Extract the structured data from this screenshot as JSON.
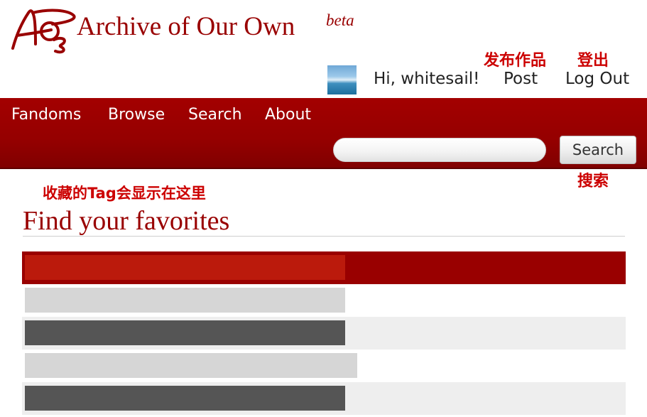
{
  "header": {
    "site_title": "Archive of Our Own",
    "beta_label": "beta",
    "user": {
      "greeting": "Hi, whitesail!",
      "post_label": "Post",
      "logout_label": "Log Out"
    }
  },
  "annotations": {
    "post": "发布作品",
    "logout": "登出",
    "search": "搜索",
    "favorite_tags": "收藏的Tag会显示在这里"
  },
  "nav": {
    "items": [
      "Fandoms",
      "Browse",
      "Search",
      "About"
    ]
  },
  "search": {
    "input_value": "",
    "button_label": "Search"
  },
  "main": {
    "heading": "Find your favorites",
    "favorite_rows": 5
  },
  "colors": {
    "brand_red": "#990000",
    "annotation_red": "#cc0000"
  },
  "icons": {
    "logo": "ao3-logo",
    "avatar": "user-avatar-sea"
  }
}
